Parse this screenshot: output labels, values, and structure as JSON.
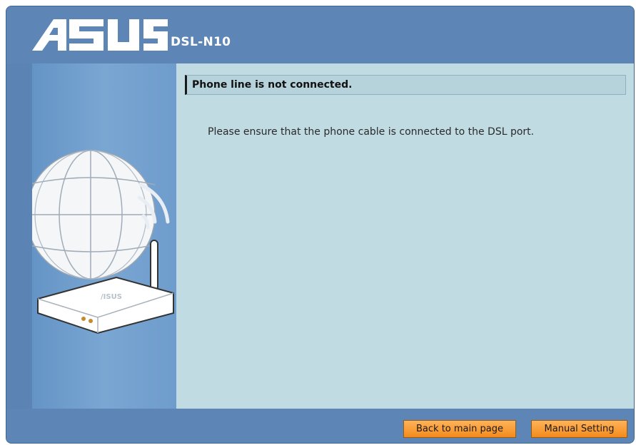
{
  "brand": {
    "logo_text": "ASUS",
    "model": "DSL-N10"
  },
  "sidebar": {
    "illustration": "router-globe-icon"
  },
  "content": {
    "title": "Phone line is not connected.",
    "message": "Please ensure that the phone cable is connected to the DSL port."
  },
  "footer": {
    "back_label": "Back to main page",
    "manual_label": "Manual Setting"
  },
  "colors": {
    "frame": "#5b84b4",
    "content_bg": "#c1dbe3",
    "button": "#f48b1b"
  }
}
